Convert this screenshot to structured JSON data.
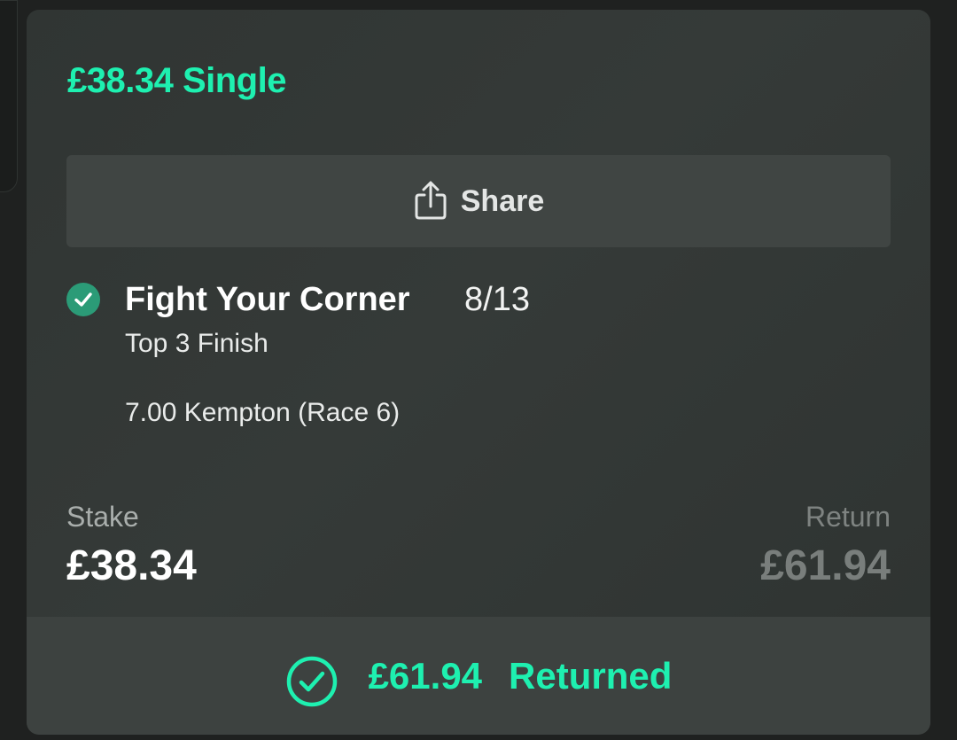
{
  "colors": {
    "accent": "#1ef0b0",
    "card_background": "#333836",
    "share_button_background": "#404543",
    "result_bar_background": "#3d4240",
    "check_badge": "#2b9b77",
    "muted_text": "#7e8381"
  },
  "bet": {
    "title": "£38.34 Single",
    "share": {
      "label": "Share",
      "icon": "share-icon"
    },
    "selection": {
      "status_icon": "check-circle-icon",
      "name": "Fight Your Corner",
      "odds": "8/13",
      "market": "Top 3 Finish",
      "event": "7.00 Kempton (Race 6)"
    },
    "stake": {
      "label": "Stake",
      "value": "£38.34"
    },
    "return": {
      "label": "Return",
      "value": "£61.94"
    },
    "result": {
      "icon": "check-circle-outline-icon",
      "amount": "£61.94",
      "label": "Returned"
    }
  }
}
